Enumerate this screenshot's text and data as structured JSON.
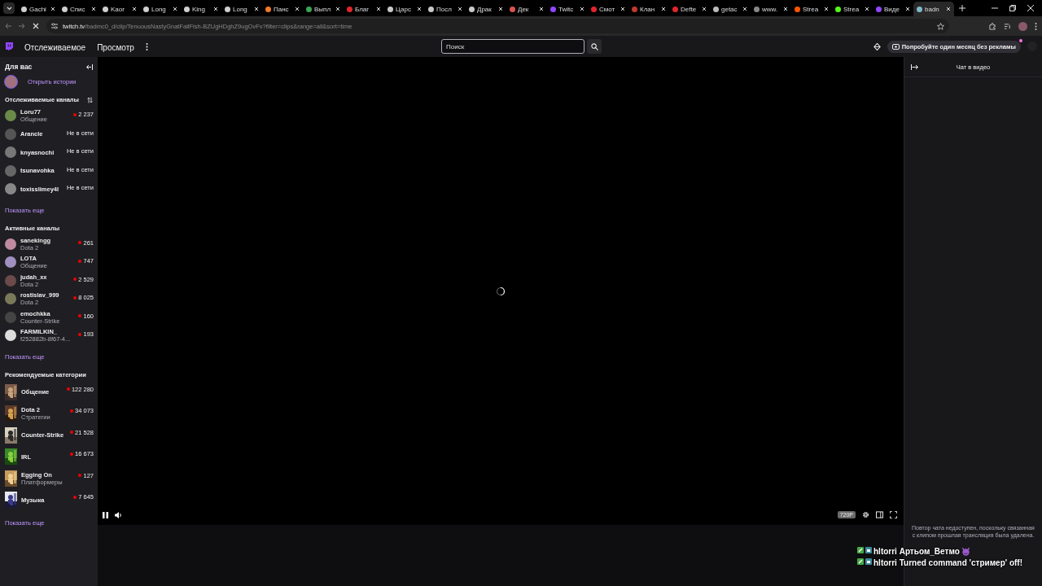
{
  "browser": {
    "tabs": [
      {
        "label": "Gachi",
        "color": "#d0d0d0",
        "selected": false
      },
      {
        "label": "Спис",
        "color": "#d0d0d0",
        "selected": false
      },
      {
        "label": "Kaor",
        "color": "#d0d0d0",
        "selected": false
      },
      {
        "label": "Long",
        "color": "#d0d0d0",
        "selected": false
      },
      {
        "label": "King",
        "color": "#d0d0d0",
        "selected": false
      },
      {
        "label": "Long",
        "color": "#d0d0d0",
        "selected": false
      },
      {
        "label": "Панс",
        "color": "#f07a2a",
        "selected": false
      },
      {
        "label": "Выпл",
        "color": "#3aa655",
        "selected": false
      },
      {
        "label": "Благ",
        "color": "#e0262b",
        "selected": false
      },
      {
        "label": "Царс",
        "color": "#c9c9c9",
        "selected": false
      },
      {
        "label": "Посл",
        "color": "#c9c9c9",
        "selected": false
      },
      {
        "label": "Драк",
        "color": "#c9c9c9",
        "selected": false
      },
      {
        "label": "Дек",
        "color": "#d9534f",
        "selected": false
      },
      {
        "label": "Twitc",
        "color": "#9146ff",
        "selected": false
      },
      {
        "label": "Смот",
        "color": "#e0262b",
        "selected": false
      },
      {
        "label": "Клан",
        "color": "#c0392b",
        "selected": false
      },
      {
        "label": "Defte",
        "color": "#e0262b",
        "selected": false
      },
      {
        "label": "getac",
        "color": "#bbbbbb",
        "selected": false
      },
      {
        "label": "www.",
        "color": "#888888",
        "selected": false
      },
      {
        "label": "Strea",
        "color": "#ff5500",
        "selected": false
      },
      {
        "label": "Strea",
        "color": "#53fc18",
        "selected": false
      },
      {
        "label": "Виде",
        "color": "#9146ff",
        "selected": false
      },
      {
        "label": "badn",
        "color": "#7fb8c8",
        "selected": true
      }
    ],
    "url": {
      "host": "twitch.tv",
      "path": "/badmc0_d/clip/TenuousNastyGnatFailFish-BZUgHDghZ9ugOvFv?filter=clips&range=all&sort=time"
    }
  },
  "nav": {
    "links": [
      "Отслеживаемое",
      "Просмотр"
    ],
    "search": {
      "placeholder": "Поиск"
    },
    "promo": "Попробуйте один месяц без рекламы"
  },
  "sidebar": {
    "title": "Для вас",
    "stories": "Открыть истории",
    "sections": [
      {
        "title": "Отслеживаемые каналы",
        "channels": [
          {
            "kind": "channel",
            "name": "Loru77",
            "category": "Общение",
            "live": true,
            "count": "2 237"
          },
          {
            "kind": "channel",
            "name": "Arancle",
            "live": false,
            "count": "Не в сети"
          },
          {
            "kind": "channel",
            "name": "knyasnochi",
            "live": false,
            "count": "Не в сети"
          },
          {
            "kind": "channel",
            "name": "tsunavohka",
            "live": false,
            "count": "Не в сети"
          },
          {
            "kind": "channel",
            "name": "toxisslimey4l",
            "live": false,
            "count": "Не в сети"
          }
        ],
        "more": "Показать еще"
      },
      {
        "title": "Активные каналы",
        "channels": [
          {
            "kind": "channel",
            "name": "sanekingg",
            "category": "Dota 2",
            "live": true,
            "count": "261"
          },
          {
            "kind": "channel",
            "name": "LOTA",
            "category": "Общение",
            "live": true,
            "count": "747"
          },
          {
            "kind": "channel",
            "name": "judah_xx",
            "category": "Dota 2",
            "live": true,
            "count": "2 529"
          },
          {
            "kind": "channel",
            "name": "rostislav_999",
            "category": "Dota 2",
            "live": true,
            "count": "8 025"
          },
          {
            "kind": "channel",
            "name": "emochkka",
            "category": "Counter-Strike",
            "live": true,
            "count": "160"
          },
          {
            "kind": "channel",
            "name": "FARMILKIN_",
            "category": "f252882b-8f67-4...",
            "live": true,
            "count": "193"
          }
        ],
        "more": "Показать еще"
      },
      {
        "title": "Рекомендуемые категории",
        "channels": [
          {
            "kind": "category",
            "name": "Общение",
            "live": true,
            "count": "122 280"
          },
          {
            "kind": "category",
            "name": "Dota 2",
            "category": "Стратегии",
            "live": true,
            "count": "34 073"
          },
          {
            "kind": "category",
            "name": "Counter-Strike",
            "live": true,
            "count": "21 528"
          },
          {
            "kind": "category",
            "name": "IRL",
            "live": true,
            "count": "16 673"
          },
          {
            "kind": "category",
            "name": "Egging On",
            "category": "Платформеры",
            "live": true,
            "count": "127"
          },
          {
            "kind": "category",
            "name": "Музыка",
            "live": true,
            "count": "7 645"
          }
        ],
        "more": "Показать еще"
      }
    ]
  },
  "player": {
    "quality": "720P"
  },
  "chat": {
    "title": "Чат в видео",
    "notice": "Повтор чата недоступен, поскольку связанная с клипом прошлая трансляция была удалена."
  },
  "overlay": {
    "lines": [
      "hltorri Артьом_Ветмо",
      "hltorri Turned command 'стример' off!"
    ]
  }
}
